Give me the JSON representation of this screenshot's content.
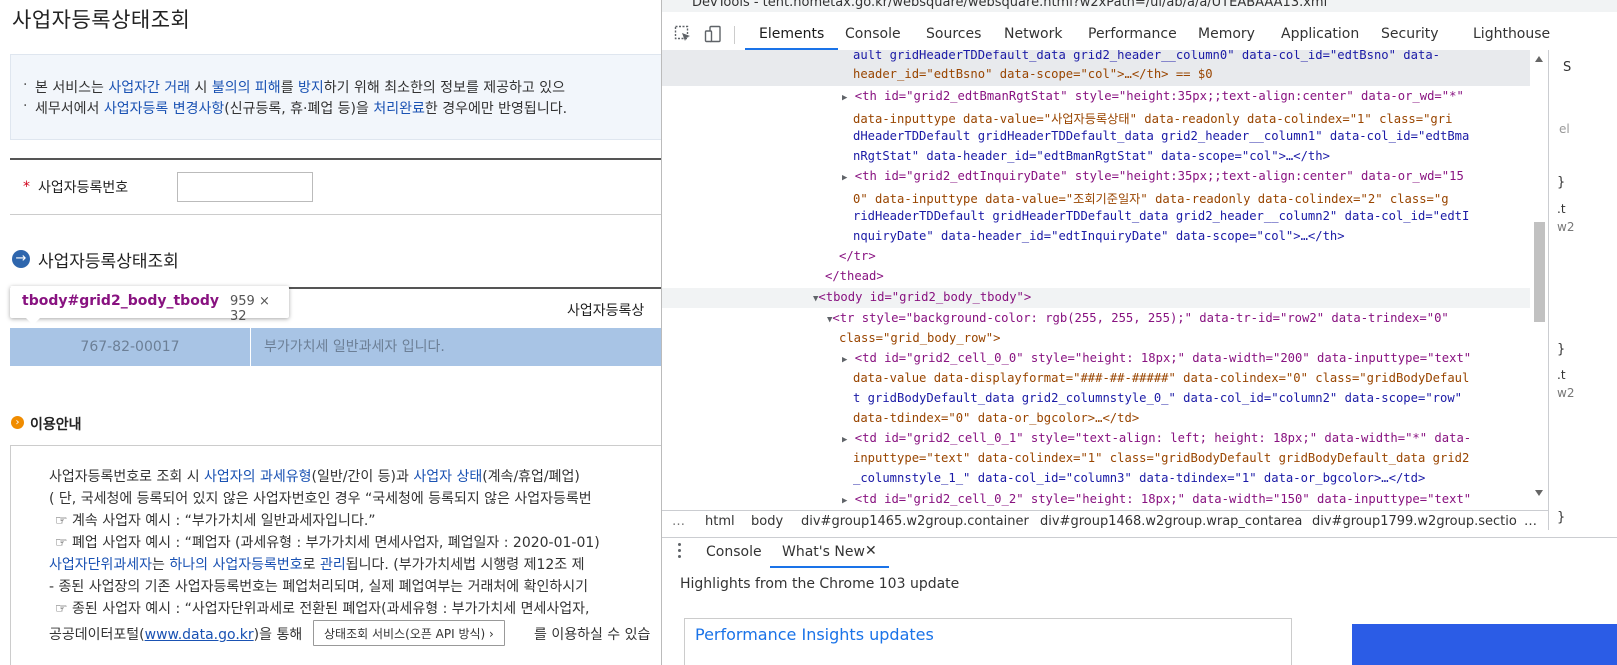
{
  "page": {
    "title": "사업자등록상태조회",
    "notice": {
      "line1": [
        "본 서비스는 ",
        "사업자간 거래",
        " 시 ",
        "불의의 피해",
        "를 ",
        "방지",
        "하기 위해 최소한의 정보를 제공하고 있으"
      ],
      "line2": [
        "세무서에서 ",
        "사업자등록 변경사항",
        "(신규등록, 휴·폐업 등)을 ",
        "처리완료",
        "한 경우에만 반영됩니다."
      ]
    },
    "search": {
      "label": "사업자등록번호",
      "required_mark": "*",
      "value": ""
    },
    "section_title": "사업자등록상태조회",
    "section_icon": "→",
    "grid": {
      "header_col1": "사업자등록상",
      "row": {
        "bsno": "767-82-00017",
        "status": "부가가치세 일반과세자 입니다."
      }
    },
    "tooltip": {
      "selector": "tbody#grid2_body_tbody",
      "size": "959 × 32"
    },
    "info": {
      "icon": "›",
      "title": "이용안내",
      "l1a": "사업자등록번호로 조회 시 ",
      "l1b": "사업자의 과세유형",
      "l1c": "(일반/간이 등)과 ",
      "l1d": "사업자 상태",
      "l1e": "(계속/휴업/폐업)",
      "l2": "( 단, 국세청에 등록되어 있지 않은 사업자번호인 경우 “국세청에 등록되지 않은 사업자등록번",
      "l3": "☞ 계속 사업자 예시 : “부가가치세 일반과세자입니다.”",
      "l4": "☞ 폐업 사업자 예시 : “폐업자 (과세유형 : 부가가치세 면세사업자, 폐업일자 : 2020-01-01)",
      "l5a": "사업자단위과세자",
      "l5b": "는 ",
      "l5c": "하나의 사업자등록번호",
      "l5d": "로 ",
      "l5e": "관리",
      "l5f": "됩니다. (부가가치세법 시행령 제12조 제",
      "l6": "- 종된 사업장의 기존 사업자등록번호는 폐업처리되며, 실제 폐업여부는 거래처에 확인하시기",
      "l7": "☞ 종된 사업자 예시 : “사업자단위과세로 전환된 폐업자(과세유형 : 부가가치세 면세사업자,",
      "l8a": "공공데이터포털(",
      "l8link": "www.data.go.kr",
      "l8b": ")을 통해",
      "api_button": "상태조회 서비스(오픈 API 방식) ›",
      "l8c": "를 이용하실 수 있습"
    }
  },
  "devtools": {
    "window_title": "DevTools - tent.hometax.go.kr/websquare/websquare.html?w2xPath=/ui/ab/a/a/UTEABAAA13.xml",
    "tabs": [
      "Elements",
      "Console",
      "Sources",
      "Network",
      "Performance",
      "Memory",
      "Application",
      "Security",
      "Lighthouse"
    ],
    "active_tab": "Elements",
    "dom_lines": {
      "l0a": "ault gridHeaderTDDefault_data grid2_header__column0\" data-col_id=\"edtBsno\" data-",
      "l0b": "header_id=\"edtBsno\" data-scope=\"col\">…</th> == $0",
      "l1a": "<th id=\"grid2_edtBmanRgtStat\" style=\"height:35px;;text-align:center\" data-or_wd=\"*\"",
      "l1b": "data-inputtype data-value=\"사업자등록상태\" data-readonly data-colindex=\"1\" class=\"gri",
      "l1c": "dHeaderTDDefault gridHeaderTDDefault_data grid2_header__column1\" data-col_id=\"edtBma",
      "l1d": "nRgtStat\" data-header_id=\"edtBmanRgtStat\" data-scope=\"col\">…</th>",
      "l2a": "<th id=\"grid2_edtInquiryDate\" style=\"height:35px;;text-align:center\" data-or_wd=\"15",
      "l2b": "0\" data-inputtype data-value=\"조회기준일자\" data-readonly data-colindex=\"2\" class=\"g",
      "l2c": "ridHeaderTDDefault gridHeaderTDDefault_data grid2_header__column2\" data-col_id=\"edtI",
      "l2d": "nquiryDate\" data-header_id=\"edtInquiryDate\" data-scope=\"col\">…</th>",
      "l3": "</tr>",
      "l4": "</thead>",
      "l5": "<tbody id=\"grid2_body_tbody\">",
      "l6a": "<tr style=\"background-color: rgb(255, 255, 255);\" data-tr-id=\"row2\" data-trindex=\"0\"",
      "l6b": "class=\"grid_body_row\">",
      "l7a": "<td id=\"grid2_cell_0_0\" style=\"height: 18px;\" data-width=\"200\" data-inputtype=\"text\"",
      "l7b": "data-value data-displayformat=\"###-##-#####\" data-colindex=\"0\" class=\"gridBodyDefaul",
      "l7c": "t gridBodyDefault_data grid2_columnstyle_0_\" data-col_id=\"column2\" data-scope=\"row\"",
      "l7d": "data-tdindex=\"0\" data-or_bgcolor>…</td>",
      "l8a": "<td id=\"grid2_cell_0_1\" style=\"text-align: left; height: 18px;\" data-width=\"*\" data-",
      "l8b": "inputtype=\"text\" data-colindex=\"1\" class=\"gridBodyDefault gridBodyDefault_data grid2",
      "l8c": "_columnstyle_1_\" data-col_id=\"column3\" data-tdindex=\"1\" data-or_bgcolor>…</td>",
      "l9": "<td id=\"grid2_cell_0_2\" style=\"height: 18px;\" data-width=\"150\" data-inputtype=\"text\""
    },
    "styles_stub": {
      "s1": "S",
      "s2": "el",
      "s3": "}",
      "s4": ".t",
      "s5": "w2",
      "s6": "}",
      "s7": ".t",
      "s8": "w2",
      "s9": "}"
    },
    "breadcrumbs": [
      "…",
      "html",
      "body",
      "div#group1465.w2group.container",
      "div#group1468.w2group.wrap_contarea",
      "div#group1799.w2group.sectio",
      "…"
    ],
    "drawer_tabs": [
      "Console",
      "What's New"
    ],
    "drawer_active": "What's New",
    "whats_new_heading": "Highlights from the Chrome 103 update",
    "card_title": "Performance Insights updates"
  },
  "colors": {
    "accent": "#1a73e8",
    "tag": "#881280",
    "attr_name": "#994500",
    "attr_value": "#1a1aa6",
    "selected_row": "#a8c4e5"
  }
}
